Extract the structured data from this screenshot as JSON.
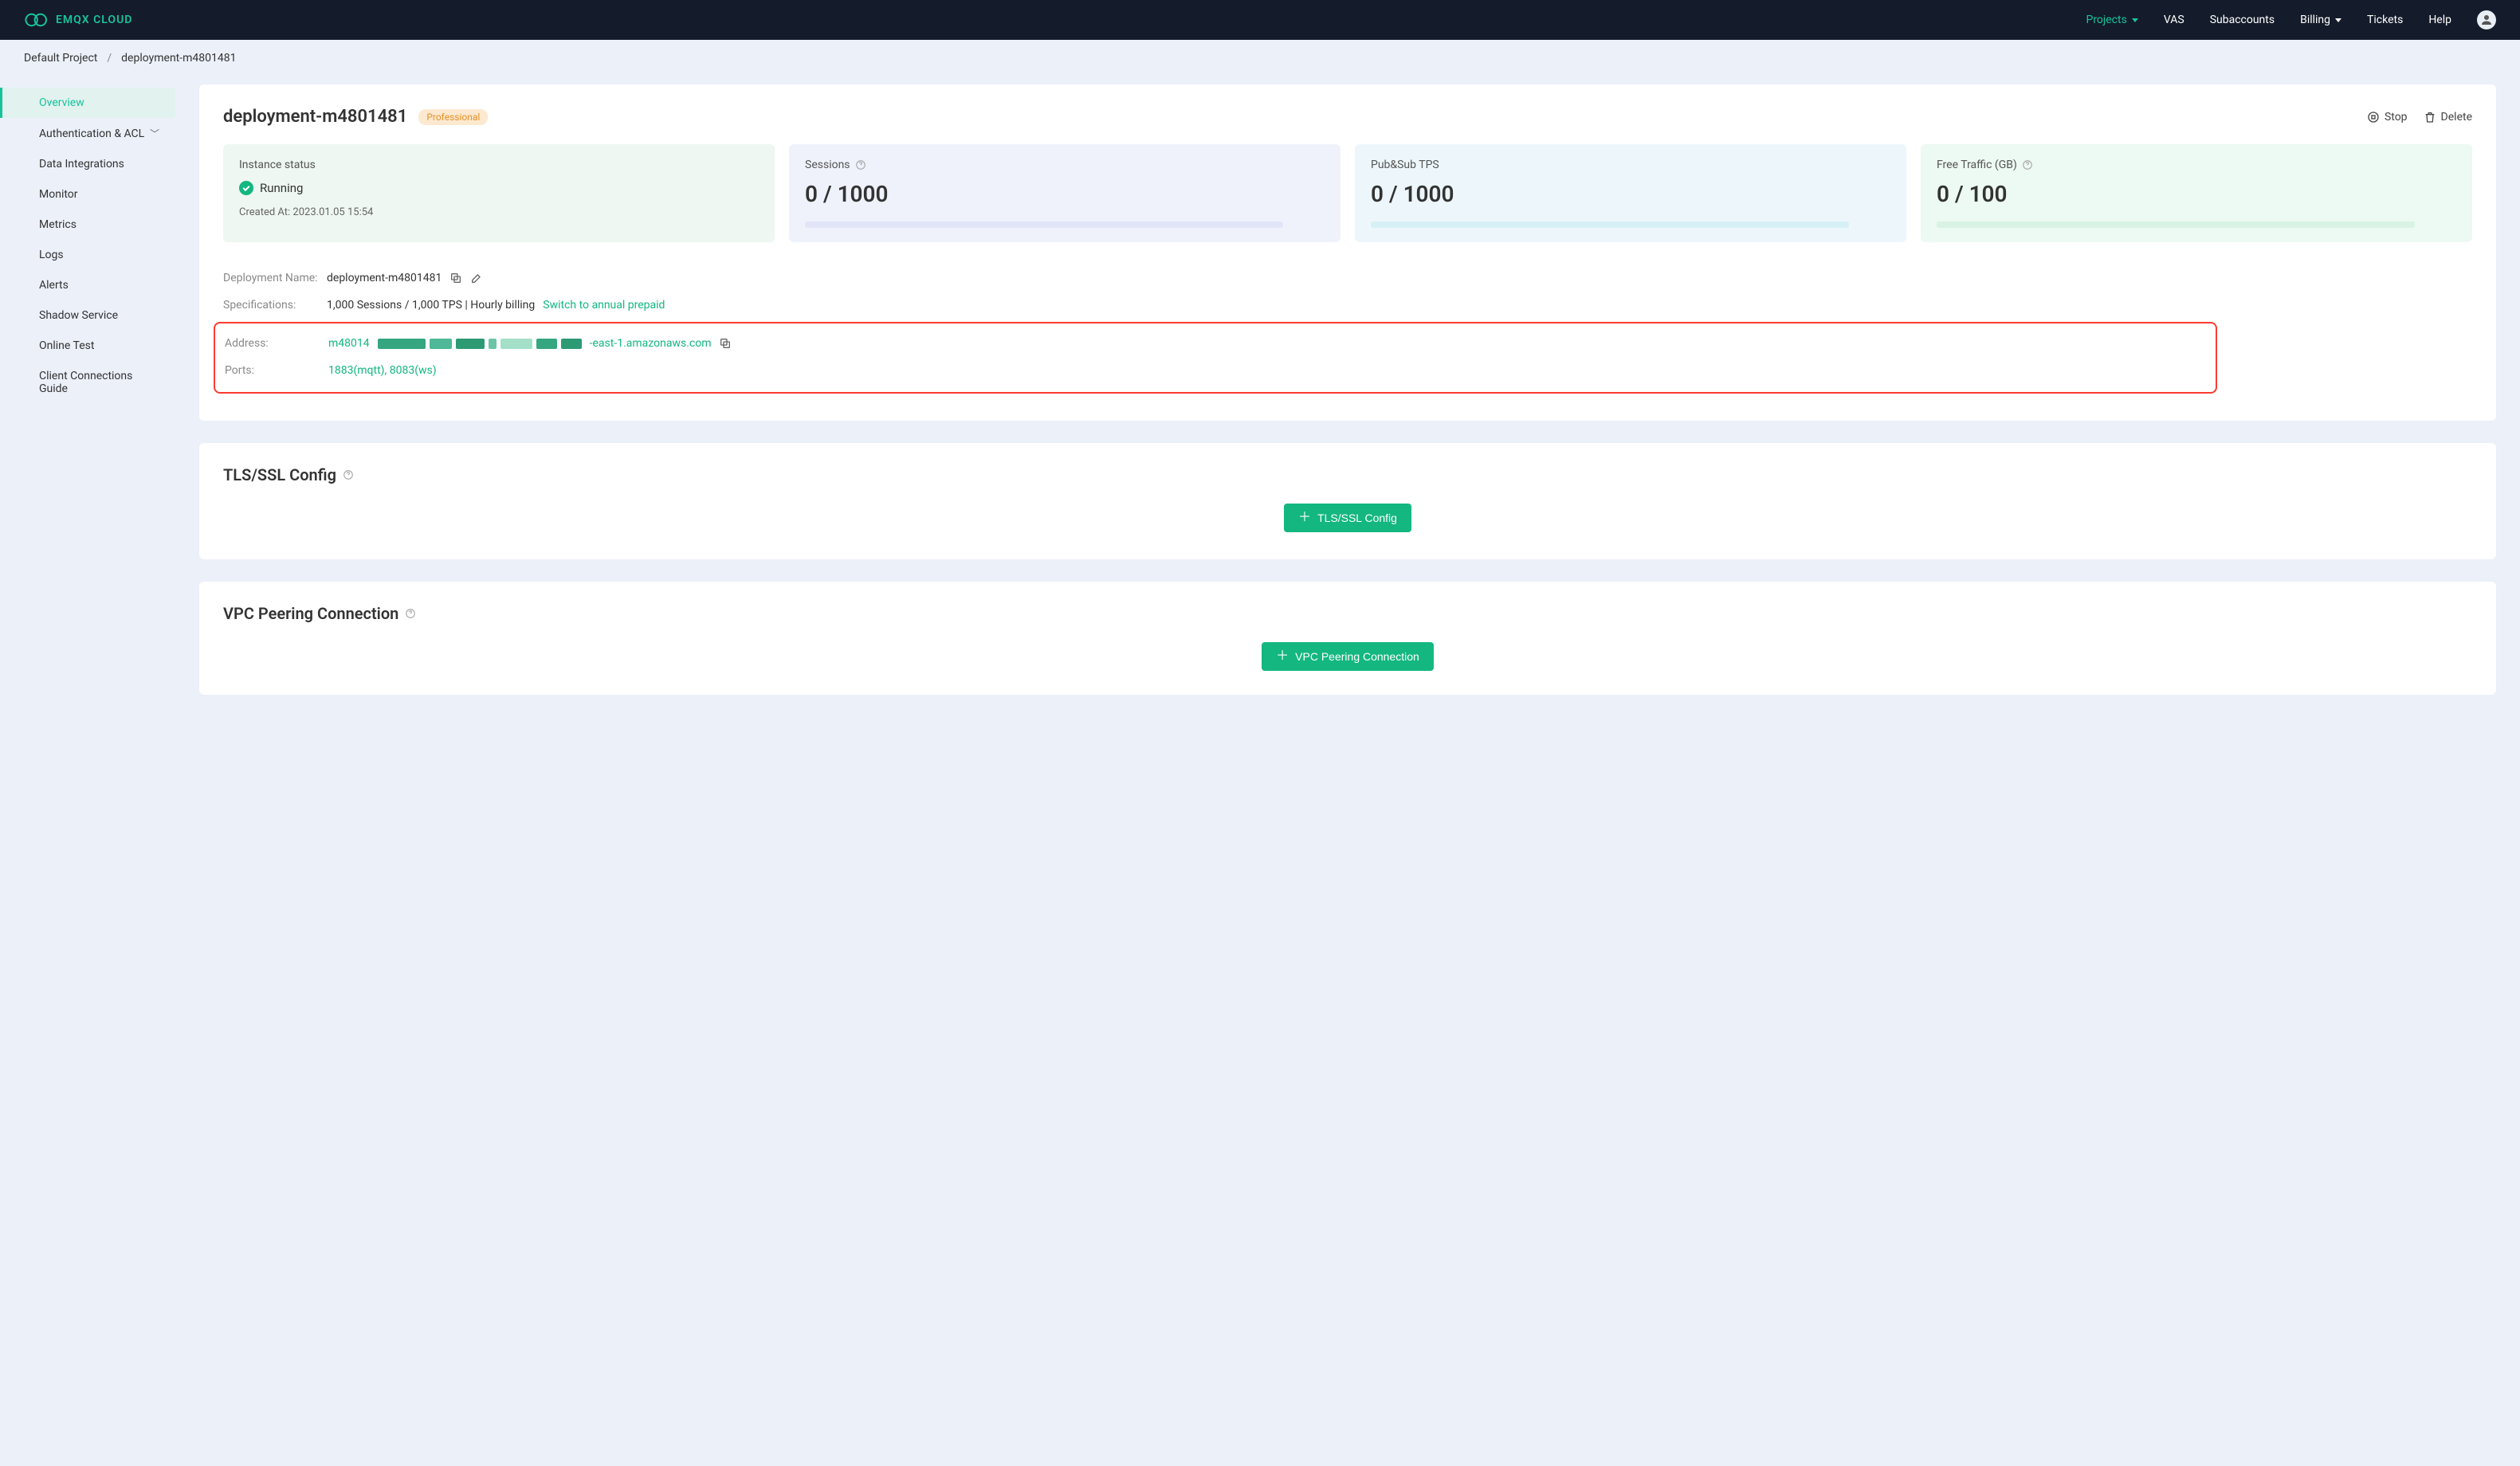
{
  "brand": "EMQX CLOUD",
  "nav": {
    "projects": "Projects",
    "vas": "VAS",
    "subaccounts": "Subaccounts",
    "billing": "Billing",
    "tickets": "Tickets",
    "help": "Help"
  },
  "breadcrumb": {
    "project": "Default Project",
    "current": "deployment-m4801481"
  },
  "sidebar": {
    "overview": "Overview",
    "auth": "Authentication & ACL",
    "integrations": "Data Integrations",
    "monitor": "Monitor",
    "metrics": "Metrics",
    "logs": "Logs",
    "alerts": "Alerts",
    "shadow": "Shadow Service",
    "online_test": "Online Test",
    "client_guide": "Client Connections Guide"
  },
  "header": {
    "title": "deployment-m4801481",
    "badge": "Professional",
    "stop": "Stop",
    "delete": "Delete"
  },
  "cards": {
    "inst_title": "Instance status",
    "inst_status": "Running",
    "inst_created_label": "Created At:",
    "inst_created_value": "2023.01.05 15:54",
    "sess_title": "Sessions",
    "sess_value": "0 / 1000",
    "pubsub_title": "Pub&Sub TPS",
    "pubsub_value": "0 / 1000",
    "traffic_title": "Free Traffic (GB)",
    "traffic_value": "0 / 100"
  },
  "info": {
    "dep_name_label": "Deployment Name:",
    "dep_name_value": "deployment-m4801481",
    "spec_label": "Specifications:",
    "spec_value": "1,000 Sessions / 1,000 TPS | Hourly billing",
    "spec_switch": "Switch to annual prepaid",
    "addr_label": "Address:",
    "addr_prefix": "m48014",
    "addr_suffix": "-east-1.amazonaws.com",
    "ports_label": "Ports:",
    "ports_value": "1883(mqtt), 8083(ws)"
  },
  "tls": {
    "title": "TLS/SSL Config",
    "button": "TLS/SSL Config"
  },
  "vpc": {
    "title": "VPC Peering Connection",
    "button": "VPC Peering Connection"
  }
}
